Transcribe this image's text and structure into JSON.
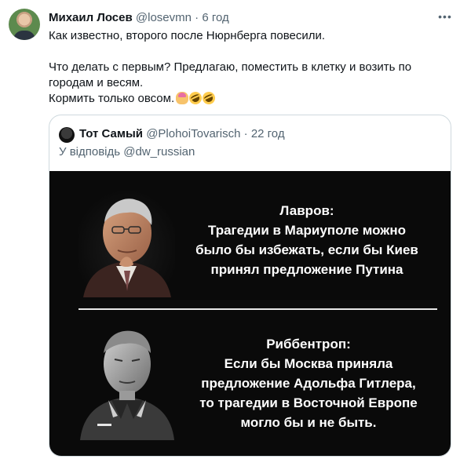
{
  "tweet": {
    "author_name": "Михаил Лосев",
    "author_handle": "@losevmn",
    "separator": "·",
    "time": "6 год",
    "more_label": "•••",
    "lines": [
      "Как известно, второго после Нюрнберга повесили.",
      "Что делать с первым? Предлагаю, поместить в клетку и возить по",
      "городам и весям.",
      "Кормить только овсом."
    ],
    "emoji": [
      "face-palm-emoji",
      "rolling-on-floor-laughing-emoji",
      "rolling-on-floor-laughing-emoji"
    ]
  },
  "quote": {
    "author_name": "Тот Самый",
    "author_handle": "@PlohoiTovarisch",
    "separator": "·",
    "time": "22 год",
    "reply_to": "У відповідь @dw_russian",
    "image": {
      "top_quote": [
        "Лавров:",
        "Трагедии в Мариуполе можно",
        "было бы избежать, если бы Киев",
        "принял предложение Путина"
      ],
      "bottom_quote": [
        "Риббентроп:",
        "Если бы Москва приняла",
        "предложение Адольфа Гитлера,",
        "то трагедии в Восточной Европе",
        "могло бы и не быть."
      ]
    }
  },
  "colors": {
    "text": "#0f1419",
    "secondary_text": "#536471",
    "border": "#cfd9de",
    "image_background": "#0a0a0a"
  }
}
